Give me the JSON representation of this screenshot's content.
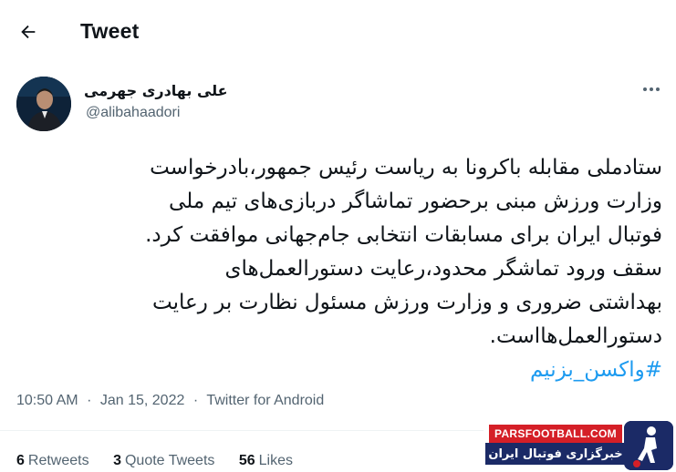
{
  "header": {
    "title": "Tweet",
    "back_icon": "arrow-left-icon"
  },
  "author": {
    "name": "علی بهادری جهرمی",
    "handle": "@alibahaadori"
  },
  "tweet": {
    "lines": [
      "ستادملی مقابله باکرونا به ریاست رئیس جمهور،بادرخواست",
      "وزارت ورزش مبنی برحضور تماشاگر دربازی‌های تیم ملی",
      "فوتبال ایران برای مسابقات انتخابی جام‌جهانی موافقت کرد.",
      "سقف ورود تماشگر محدود،رعایت دستورالعمل‌های",
      "بهداشتی ضروری و وزارت ورزش مسئول نظارت بر رعایت",
      "دستورالعمل‌هااست."
    ],
    "hashtag": "#واکسن_بزنیم"
  },
  "meta": {
    "time": "10:50 AM",
    "separator": "·",
    "date": "Jan 15, 2022",
    "source": "Twitter for Android"
  },
  "stats": [
    {
      "count": "6",
      "label": "Retweets"
    },
    {
      "count": "3",
      "label": "Quote Tweets"
    },
    {
      "count": "56",
      "label": "Likes"
    }
  ],
  "watermark": {
    "site": "PARSFOOTBALL.COM",
    "tagline": "خبرگزاری فوتبال ایران"
  },
  "colors": {
    "text": "#0f1419",
    "secondary": "#536471",
    "accent": "#1d9bf0",
    "divider": "#eff3f4",
    "watermark_red": "#d51f27",
    "watermark_navy": "#1b2a66"
  }
}
